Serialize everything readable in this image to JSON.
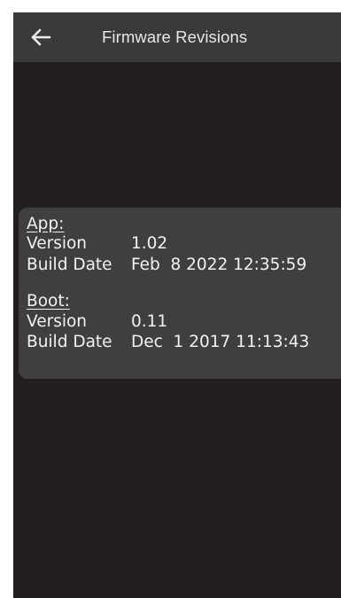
{
  "header": {
    "back_icon": "arrow-left-icon",
    "title": "Firmware Revisions"
  },
  "app": {
    "title": "App:",
    "version_label": "Version",
    "version_value": "1.02",
    "build_date_label": "Build Date",
    "build_date_value": "Feb  8 2022 12:35:59"
  },
  "boot": {
    "title": "Boot:",
    "version_label": "Version",
    "version_value": "0.11",
    "build_date_label": "Build Date",
    "build_date_value": "Dec  1 2017 11:13:43"
  },
  "colors": {
    "background": "#231f20",
    "header": "#3a3a3a",
    "card": "#3f3f3f",
    "text": "#f2f2f2"
  }
}
